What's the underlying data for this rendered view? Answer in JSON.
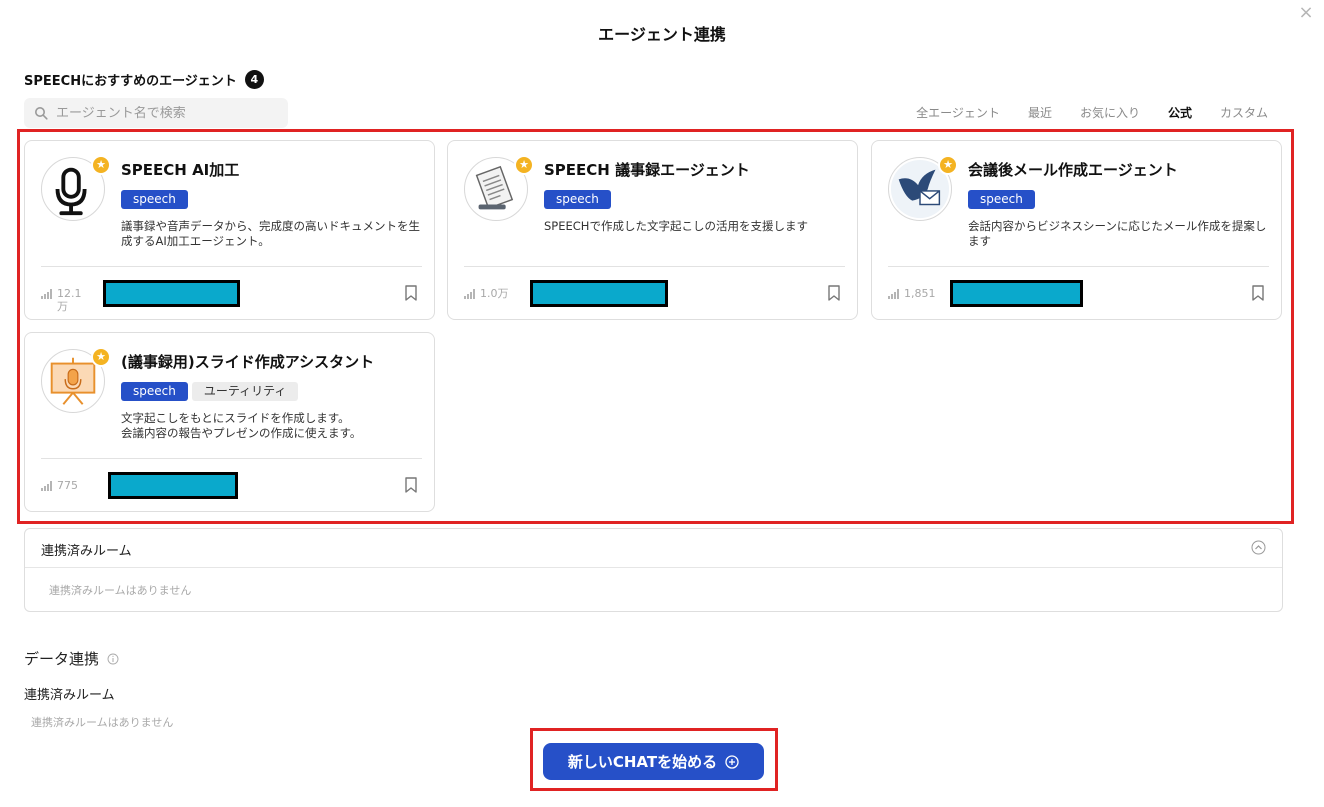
{
  "modal": {
    "title": "エージェント連携",
    "close_label": "×"
  },
  "recommend": {
    "heading": "SPEECHにおすすめのエージェント",
    "count": "4"
  },
  "search": {
    "placeholder": "エージェント名で検索"
  },
  "filters": [
    {
      "label": "全エージェント",
      "active": false
    },
    {
      "label": "最近",
      "active": false
    },
    {
      "label": "お気に入り",
      "active": false
    },
    {
      "label": "公式",
      "active": true
    },
    {
      "label": "カスタム",
      "active": false
    }
  ],
  "agents": [
    {
      "name": "SPEECH AI加工",
      "tags": [
        "speech"
      ],
      "description": "議事録や音声データから、完成度の高いドキュメントを生成するAI加工エージェント。",
      "usage": "12.1万",
      "icon": "microphone-icon"
    },
    {
      "name": "SPEECH 議事録エージェント",
      "tags": [
        "speech"
      ],
      "description": "SPEECHで作成した文字起こしの活用を支援します",
      "usage": "1.0万",
      "icon": "document-icon"
    },
    {
      "name": "会議後メール作成エージェント",
      "tags": [
        "speech"
      ],
      "description": "会話内容からビジネスシーンに応じたメール作成を提案します",
      "usage": "1,851",
      "icon": "bird-mail-icon"
    },
    {
      "name": "(議事録用)スライド作成アシスタント",
      "tags": [
        "speech",
        "ユーティリティ"
      ],
      "description_line1": "文字起こしをもとにスライドを作成します。",
      "description_line2": "会議内容の報告やプレゼンの作成に使えます。",
      "usage": "775",
      "icon": "presentation-icon"
    }
  ],
  "rooms": {
    "title": "連携済みルーム",
    "empty": "連携済みルームはありません"
  },
  "data_link": {
    "title": "データ連携",
    "subtitle": "連携済みルーム",
    "empty": "連携済みルームはありません"
  },
  "cta": {
    "label": "新しいCHATを始める"
  },
  "colors": {
    "accent": "#2650c8",
    "highlight": "#e02323",
    "star": "#f4b322",
    "redaction": "#0aa9cc"
  }
}
